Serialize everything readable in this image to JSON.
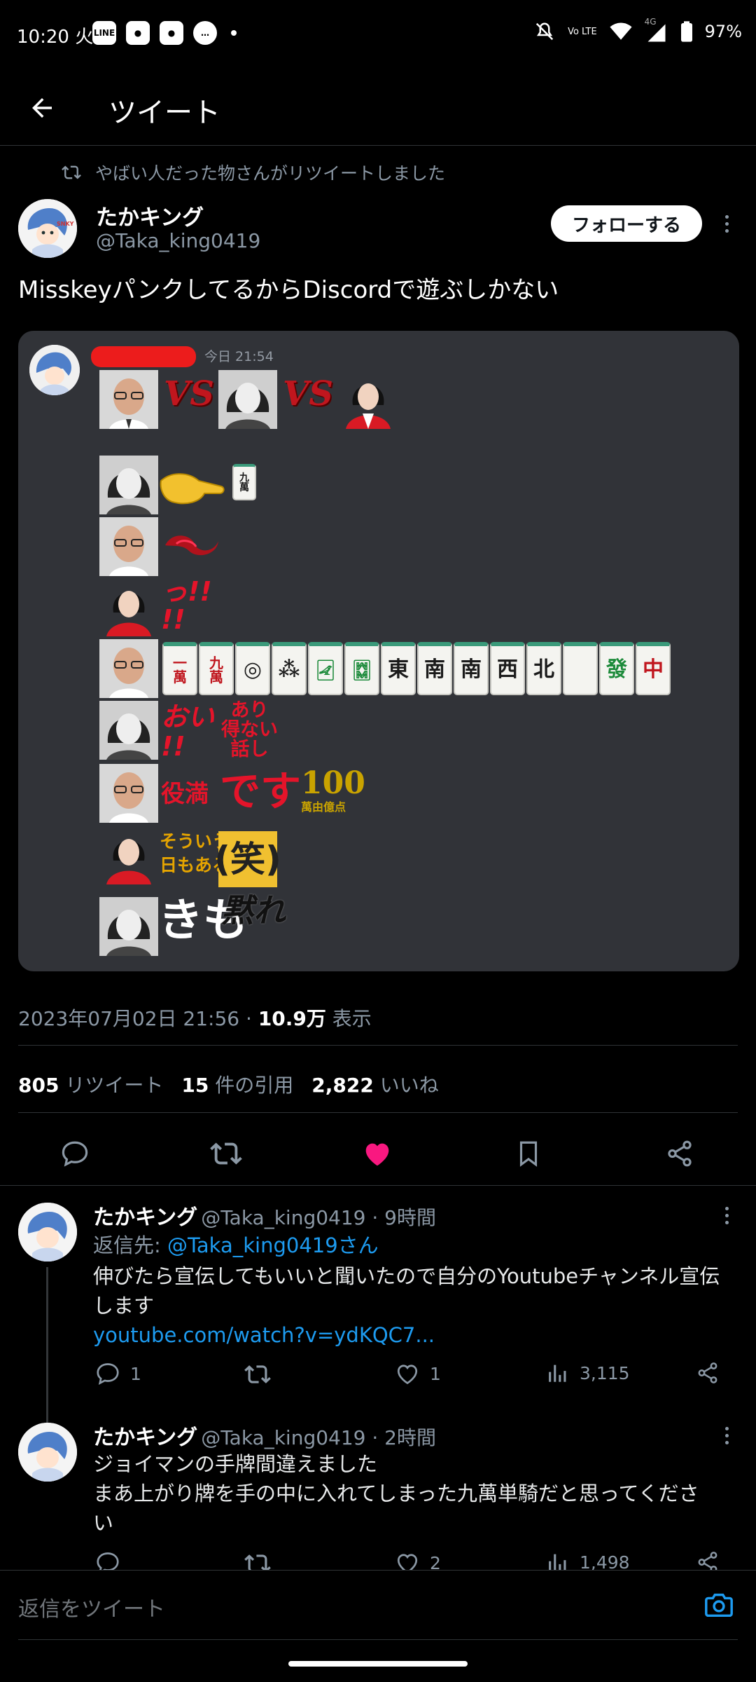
{
  "status_bar": {
    "time": "10:20 火",
    "left_icons": [
      "line-icon",
      "app-icon",
      "app-icon",
      "chat-icon"
    ],
    "network": "4G",
    "volte": "Vo LTE",
    "battery": "97%"
  },
  "app_bar": {
    "title": "ツイート",
    "back_icon": "arrow-left-icon"
  },
  "retweet_banner": {
    "text": "やばい人だった物さんがリツイートしました"
  },
  "tweet": {
    "author_name": "たかキング",
    "author_handle": "@Taka_king0419",
    "follow_label": "フォローする",
    "text": "Misskeyパンクしてるから​Discordで遊ぶしかない",
    "media": {
      "time": "今日 21:54",
      "vs_text": "VS",
      "hand_tiles": [
        "一\n萬",
        "九\n萬",
        "◎",
        "⁂",
        "🀐",
        "🀗",
        "東",
        "南",
        "南",
        "西",
        "北",
        "",
        "發",
        "中"
      ],
      "discard_tile": "九\n萬",
      "stamps": {
        "tsu": "っ!!\n!!",
        "oi": "おい\n!!",
        "arienai": "あり\n得ない\n話し",
        "yakuman": "役満",
        "desu": "です",
        "points": "100",
        "points_sub": "萬由億点",
        "souiu": "そういう\n日もある",
        "warai": "(笑)",
        "kimo": "きも",
        "damare": "黙れ"
      }
    },
    "timestamp": "2023年07月02日 21:56 · ",
    "views": "10.9万",
    "views_label": " 表示",
    "stats": {
      "retweets": "805",
      "retweets_label": "リツイート",
      "quotes": "15",
      "quotes_label": "件の引用",
      "likes": "2,822",
      "likes_label": "いいね"
    },
    "liked_color": "#f91880"
  },
  "replies": [
    {
      "name": "たかキング",
      "meta": "@Taka_king0419 · 9時間",
      "reply_to_prefix": "返信先: ",
      "reply_to": "@Taka_king0419さん",
      "text_1": "伸びたら宣伝してもいいと聞いたので自分のYoutubeチャンネル宣伝",
      "text_2": "します",
      "link": "youtube.com/watch?v=ydKQC7...",
      "replies": "1",
      "likes": "1",
      "views": "3,115"
    },
    {
      "name": "たかキング",
      "meta": "@Taka_king0419 · 2時間",
      "text_1": "ジョイマンの手牌間違えました",
      "text_2": "まあ上がり牌を手の中に入れてしまった九萬単騎だと思ってくださ",
      "text_3": "い",
      "replies": "",
      "likes": "2",
      "views": "1,498"
    }
  ],
  "reply_bar": {
    "placeholder": "返信をツイート"
  },
  "accent": "#1d9bf0"
}
